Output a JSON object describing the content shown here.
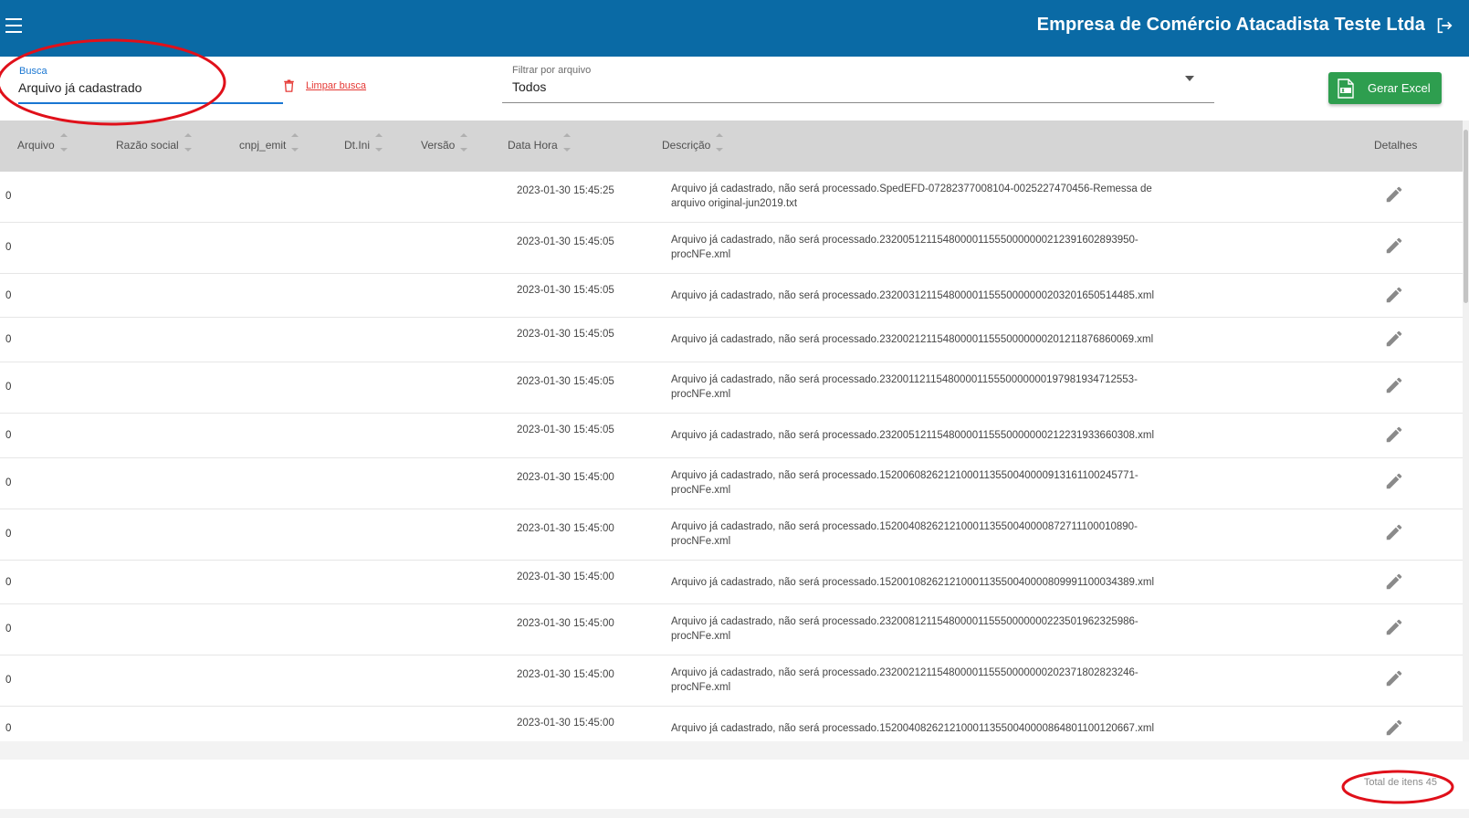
{
  "header": {
    "company_name": "Empresa de Comércio Atacadista Teste Ltda"
  },
  "search": {
    "label": "Busca",
    "value": "Arquivo já cadastrado",
    "clear_label": "Limpar busca"
  },
  "file_filter": {
    "label": "Filtrar por arquivo",
    "value": "Todos"
  },
  "export": {
    "label": "Gerar Excel"
  },
  "table": {
    "columns": [
      "Arquivo",
      "Razão social",
      "cnpj_emit",
      "Dt.Ini",
      "Versão",
      "Data Hora",
      "Descrição",
      "Detalhes"
    ],
    "rows": [
      {
        "arquivo": "0",
        "data_hora": "2023-01-30 15:45:25",
        "descricao": "Arquivo já cadastrado, não será processado.SpedEFD-07282377008104-0025227470456-Remessa de arquivo original-jun2019.txt"
      },
      {
        "arquivo": "0",
        "data_hora": "2023-01-30 15:45:05",
        "descricao": "Arquivo já cadastrado, não será processado.23200512115480000115550000000212391602893950-procNFe.xml"
      },
      {
        "arquivo": "0",
        "data_hora": "2023-01-30 15:45:05",
        "descricao": "Arquivo já cadastrado, não será processado.23200312115480000115550000000203201650514485.xml"
      },
      {
        "arquivo": "0",
        "data_hora": "2023-01-30 15:45:05",
        "descricao": "Arquivo já cadastrado, não será processado.23200212115480000115550000000201211876860069.xml"
      },
      {
        "arquivo": "0",
        "data_hora": "2023-01-30 15:45:05",
        "descricao": "Arquivo já cadastrado, não será processado.23200112115480000115550000000197981934712553-procNFe.xml"
      },
      {
        "arquivo": "0",
        "data_hora": "2023-01-30 15:45:05",
        "descricao": "Arquivo já cadastrado, não será processado.23200512115480000115550000000212231933660308.xml"
      },
      {
        "arquivo": "0",
        "data_hora": "2023-01-30 15:45:00",
        "descricao": "Arquivo já cadastrado, não será processado.15200608262121000113550040000913161100245771-procNFe.xml"
      },
      {
        "arquivo": "0",
        "data_hora": "2023-01-30 15:45:00",
        "descricao": "Arquivo já cadastrado, não será processado.15200408262121000113550040000872711100010890-procNFe.xml"
      },
      {
        "arquivo": "0",
        "data_hora": "2023-01-30 15:45:00",
        "descricao": "Arquivo já cadastrado, não será processado.15200108262121000113550040000809991100034389.xml"
      },
      {
        "arquivo": "0",
        "data_hora": "2023-01-30 15:45:00",
        "descricao": "Arquivo já cadastrado, não será processado.23200812115480000115550000000223501962325986-procNFe.xml"
      },
      {
        "arquivo": "0",
        "data_hora": "2023-01-30 15:45:00",
        "descricao": "Arquivo já cadastrado, não será processado.23200212115480000115550000000202371802823246-procNFe.xml"
      },
      {
        "arquivo": "0",
        "data_hora": "2023-01-30 15:45:00",
        "descricao": "Arquivo já cadastrado, não será processado.15200408262121000113550040000864801100120667.xml"
      }
    ]
  },
  "footer": {
    "total_label": "Total de itens 45"
  },
  "colors": {
    "header_bg": "#0a6aa5",
    "primary": "#1976d2",
    "excel_green": "#2e9e4f",
    "danger": "#e53935",
    "annotation_red": "#e0101a"
  },
  "icons": {
    "menu": "hamburger-icon",
    "logout": "logout-icon",
    "clear": "trash-icon",
    "excel": "xlsx-file-icon",
    "sort": "sort-arrows-icon",
    "edit": "pencil-icon"
  }
}
